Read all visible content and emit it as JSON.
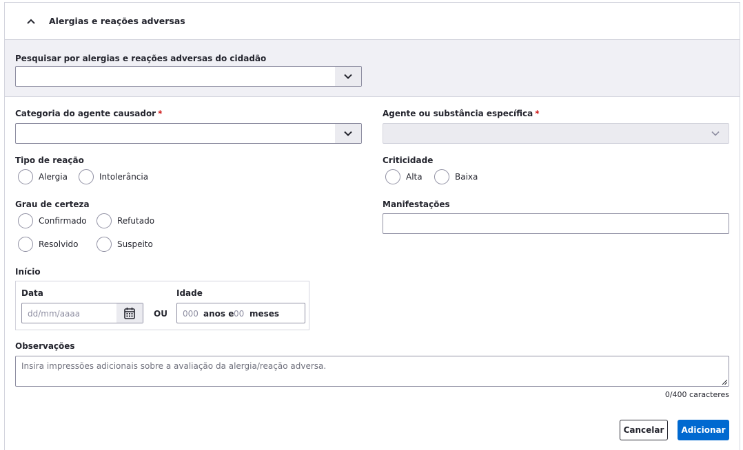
{
  "header": {
    "title": "Alergias e reações adversas"
  },
  "search": {
    "label": "Pesquisar por alergias e reações adversas do cidadão",
    "value": ""
  },
  "categoria": {
    "label": "Categoria do agente causador",
    "required_mark": "*",
    "value": ""
  },
  "agente": {
    "label": "Agente ou substância específica",
    "required_mark": "*",
    "value": ""
  },
  "tipo_reacao": {
    "label": "Tipo de reação",
    "options": [
      "Alergia",
      "Intolerância"
    ]
  },
  "criticidade": {
    "label": "Criticidade",
    "options": [
      "Alta",
      "Baixa"
    ]
  },
  "grau_certeza": {
    "label": "Grau de certeza",
    "options": [
      "Confirmado",
      "Refutado",
      "Resolvido",
      "Suspeito"
    ]
  },
  "manifestacoes": {
    "label": "Manifestações",
    "value": ""
  },
  "inicio": {
    "label": "Início",
    "data_label": "Data",
    "data_placeholder": "dd/mm/aaaa",
    "ou": "OU",
    "idade_label": "Idade",
    "anos_placeholder": "000",
    "anos_unit": "anos e",
    "meses_placeholder": "00",
    "meses_unit": "meses"
  },
  "observacoes": {
    "label": "Observações",
    "placeholder": "Insira impressões adicionais sobre a avaliação da alergia/reação adversa.",
    "counter": "0/400 caracteres"
  },
  "actions": {
    "cancel": "Cancelar",
    "add": "Adicionar"
  },
  "colors": {
    "primary": "#0069d0",
    "required": "#d01e1e",
    "band": "#f0f0f5"
  }
}
